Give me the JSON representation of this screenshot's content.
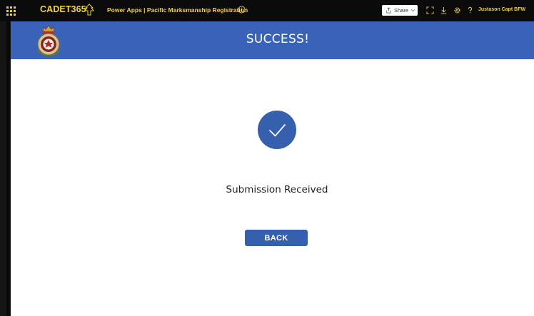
{
  "topbar": {
    "brand": "CADET365",
    "app_title": "Power Apps  |  Pacific Marksmanship Registration",
    "share_label": "Share",
    "user_name": "Justason Capt BFW"
  },
  "header": {
    "title": "SUCCESS!"
  },
  "body": {
    "message": "Submission Received",
    "back_label": "BACK"
  },
  "colors": {
    "topbar_bg": "#0b0b0b",
    "brand_yellow": "#f1d24b",
    "header_blue": "#3a62b8",
    "button_blue": "#3560ad",
    "background": "#ffffff"
  },
  "icons": {
    "waffle": "app-launcher-icon",
    "info": "info-icon",
    "share": "share-icon",
    "fit": "fit-to-screen-icon",
    "download": "download-icon",
    "settings": "gear-icon",
    "help": "help-icon",
    "check": "checkmark-icon",
    "crest": "cadet-crest-logo"
  }
}
